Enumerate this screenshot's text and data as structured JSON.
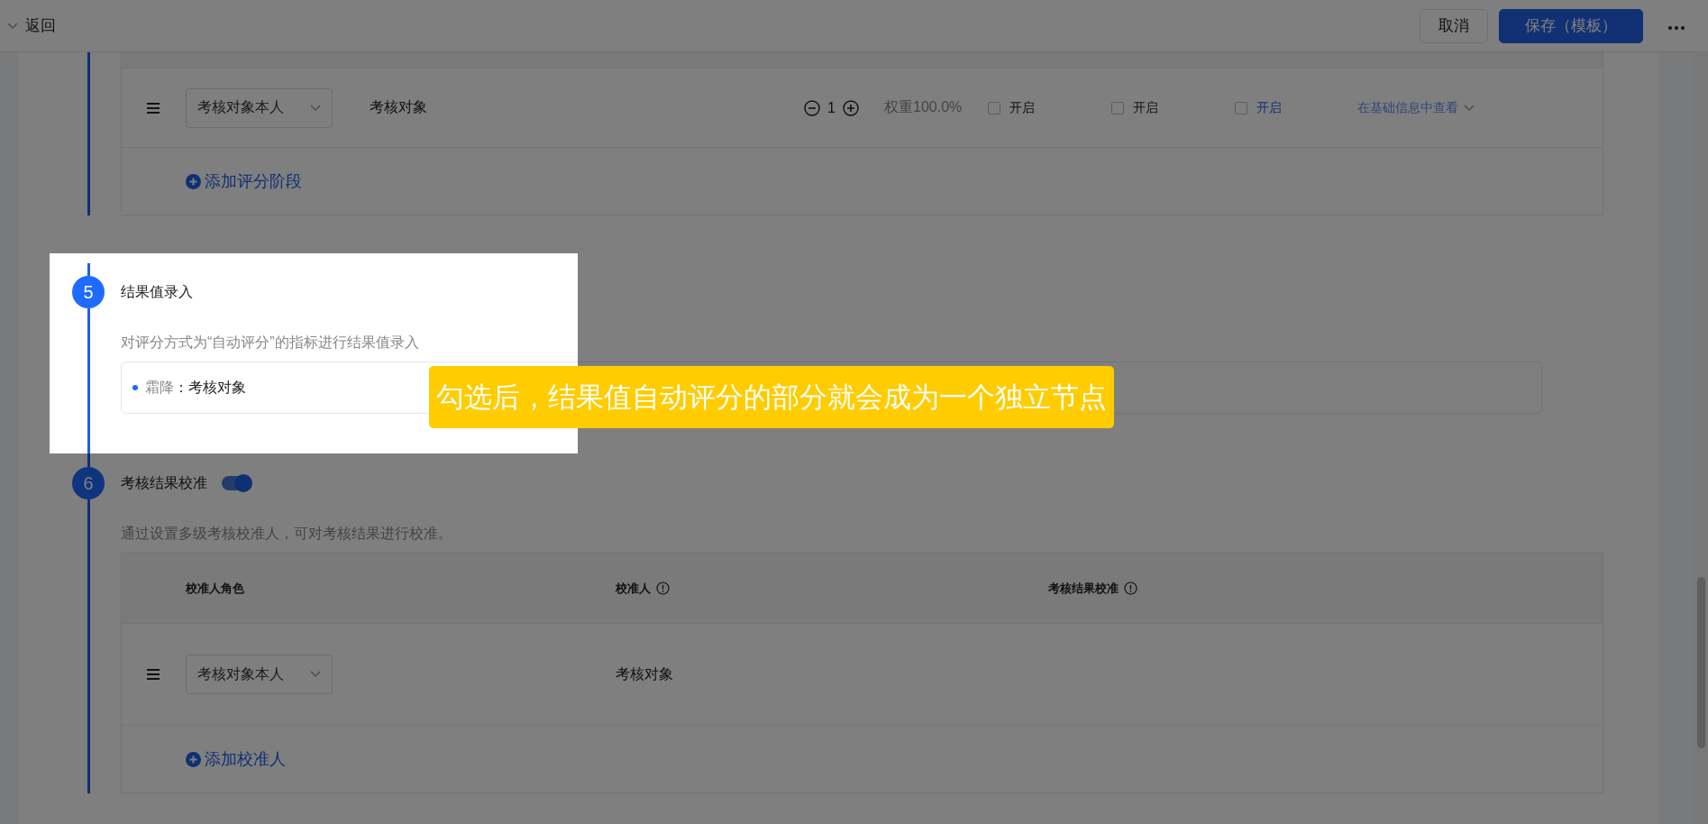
{
  "top_bar": {
    "back": "返回",
    "cancel": "取消",
    "save": "保存（模板）"
  },
  "scoring_table": {
    "rows": [
      {
        "role": "考核对象本人",
        "target": "考核对象",
        "count": "1",
        "weight": "权重100.0%",
        "options": [
          {
            "label": "开启",
            "checked": false,
            "kind": "plain"
          },
          {
            "label": "开启",
            "checked": false,
            "kind": "plain"
          },
          {
            "label": "开启",
            "checked": false,
            "kind": "link"
          }
        ],
        "view": "在基础信息中查看"
      }
    ],
    "add": "添加评分阶段"
  },
  "steps": [
    {
      "kind": "entries",
      "number": "5",
      "title": "结果值录入",
      "description": "对评分方式为“自动评分”的指标进行结果值录入",
      "entries": [
        {
          "label": "霜降",
          "value": "：考核对象"
        }
      ]
    },
    {
      "kind": "table",
      "number": "6",
      "title": "考核结果校准",
      "toggle_on": true,
      "description": "通过设置多级考核校准人，可对考核结果进行校准。",
      "table": {
        "columns": [
          {
            "label": "校准人角色",
            "info": false
          },
          {
            "label": "校准人",
            "info": true
          },
          {
            "label": "考核结果校准",
            "info": true
          }
        ],
        "rows": [
          {
            "role": "考核对象本人",
            "person": "考核对象"
          }
        ],
        "add": "添加校准人"
      }
    }
  ],
  "callout": "勾选后，结果值自动评分的部分就会成为一个独立节点"
}
